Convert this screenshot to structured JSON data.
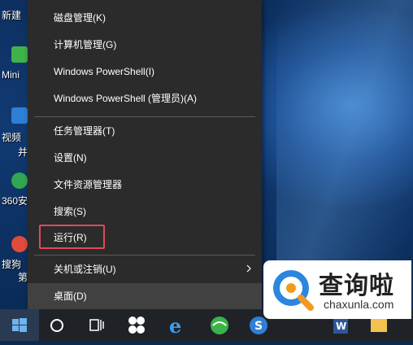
{
  "desktop": {
    "icons": [
      {
        "label": "新建",
        "icon": "new-file-icon",
        "color": "#e8e8e8"
      },
      {
        "label": "Mini",
        "icon": "app-icon",
        "color": "#3fb24a"
      },
      {
        "label": "视频",
        "icon": "video-icon",
        "color": "#2e7fd6"
      },
      {
        "label": "并",
        "icon": "",
        "color": ""
      },
      {
        "label": "360安",
        "icon": "shield-icon",
        "color": "#2fa84f"
      },
      {
        "label": "搜狗",
        "icon": "sogou-icon",
        "color": "#e24a3b"
      },
      {
        "label": "第",
        "icon": "",
        "color": ""
      }
    ]
  },
  "menu": {
    "items": [
      {
        "label": "磁盘管理(K)"
      },
      {
        "label": "计算机管理(G)"
      },
      {
        "label": "Windows PowerShell(I)"
      },
      {
        "label": "Windows PowerShell (管理员)(A)"
      },
      {
        "label": "任务管理器(T)"
      },
      {
        "label": "设置(N)"
      },
      {
        "label": "文件资源管理器"
      },
      {
        "label": "搜索(S)"
      },
      {
        "label": "运行(R)"
      },
      {
        "label": "关机或注销(U)"
      },
      {
        "label": "桌面(D)"
      }
    ],
    "highlight_color": "#e04a5a"
  },
  "taskbar": {
    "icons": [
      "windows-start-icon",
      "cortana-circle-icon",
      "task-view-icon",
      "pinwheel-app-icon",
      "edge-browser-icon",
      "360-browser-icon",
      "sogou-browser-icon",
      "word-icon",
      "explorer-icon"
    ]
  },
  "watermark": {
    "title": "查询啦",
    "url": "chaxunla.com"
  }
}
